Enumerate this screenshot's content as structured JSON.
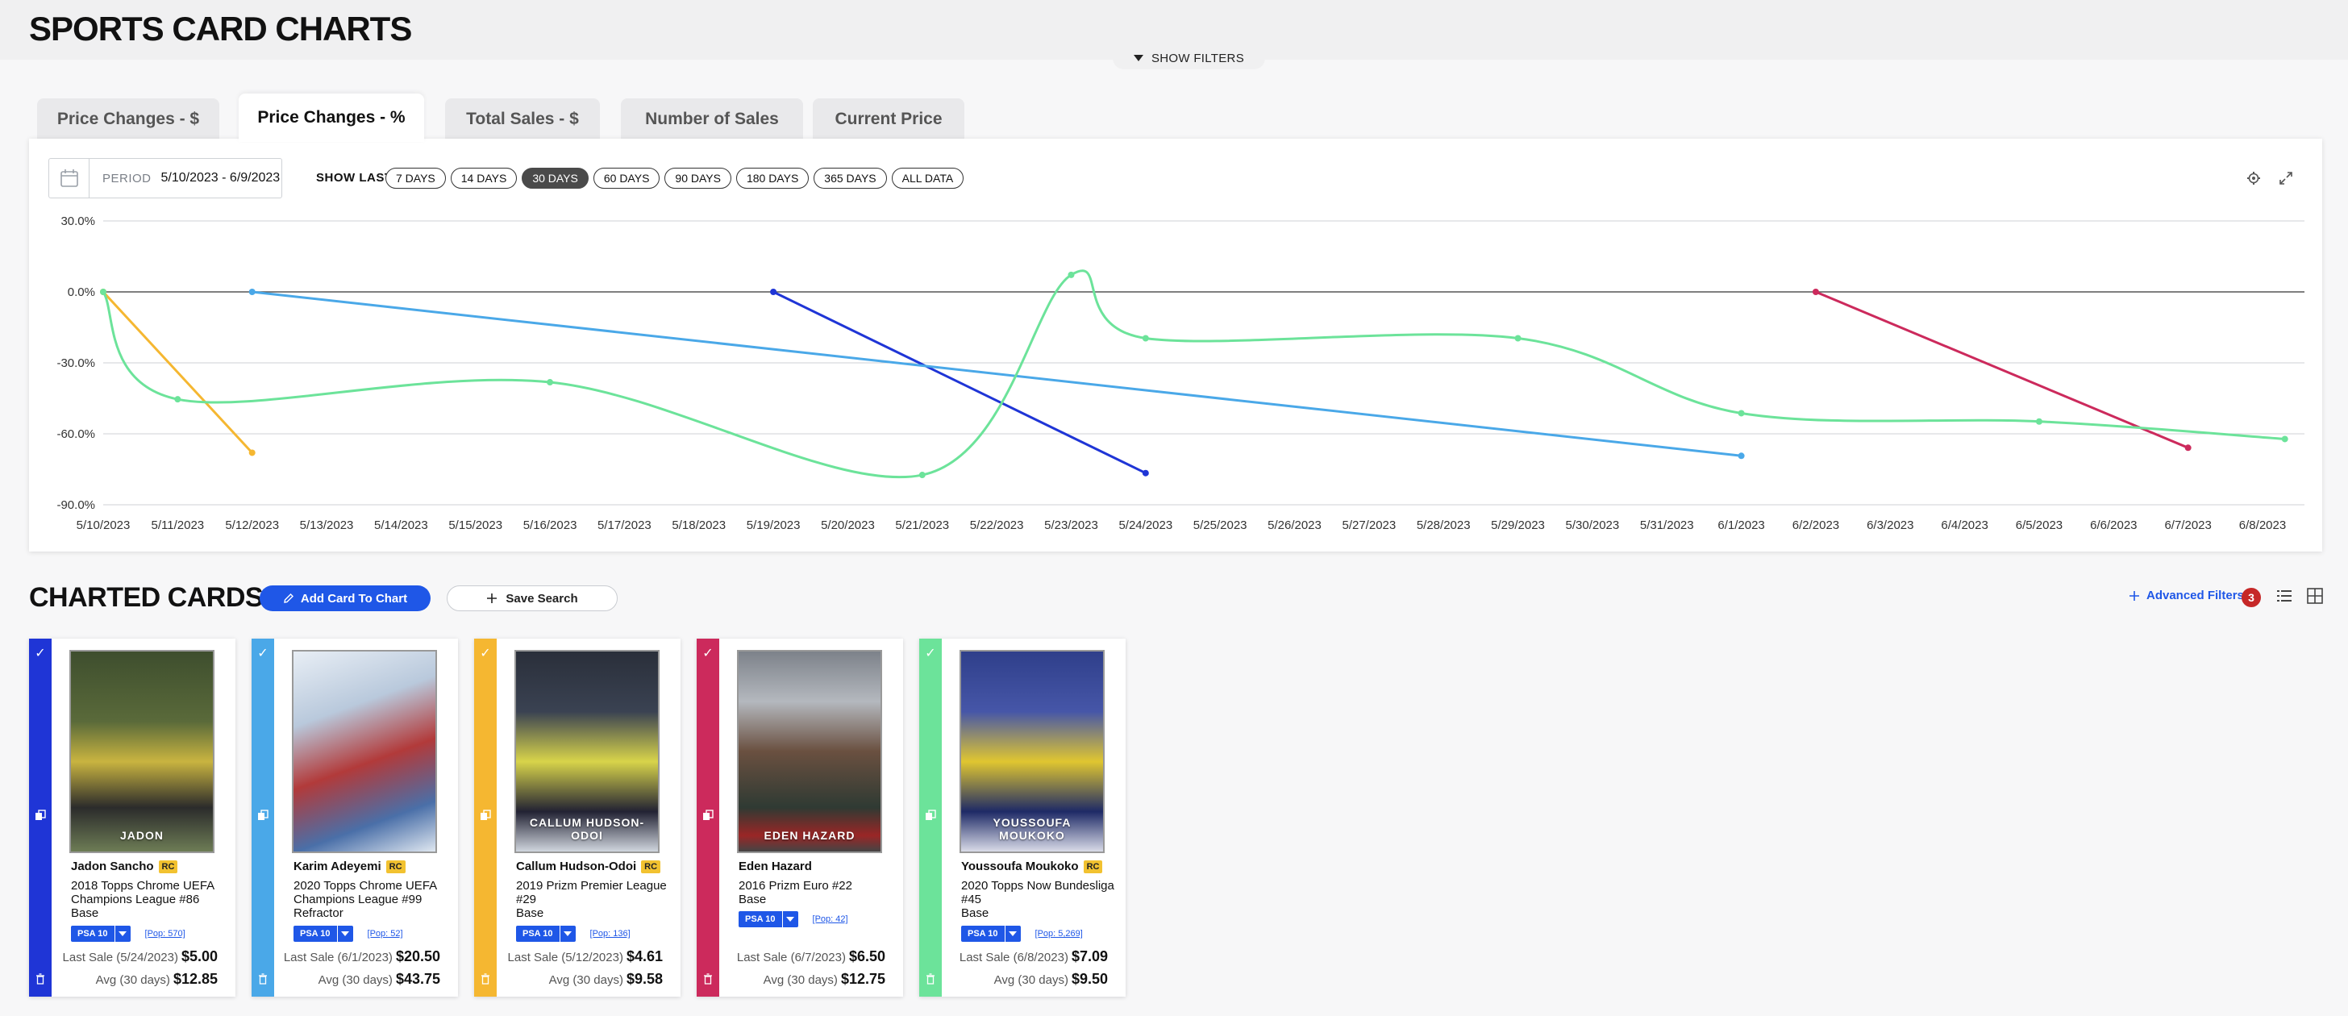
{
  "app": {
    "title": "SPORTS CARD CHARTS",
    "show_filters": "SHOW FILTERS"
  },
  "tabs": [
    {
      "label": "Price Changes - $"
    },
    {
      "label": "Price Changes - %",
      "active": true
    },
    {
      "label": "Total Sales - $"
    },
    {
      "label": "Number of Sales"
    },
    {
      "label": "Current Price"
    }
  ],
  "period": {
    "label": "PERIOD",
    "value": "5/10/2023 - 6/9/2023"
  },
  "show_last": {
    "label": "SHOW LAST",
    "selected": "30 DAYS",
    "options": [
      "7 DAYS",
      "14 DAYS",
      "30 DAYS",
      "60 DAYS",
      "90 DAYS",
      "180 DAYS",
      "365 DAYS",
      "ALL DATA"
    ]
  },
  "icons": {
    "calendar": "calendar-icon",
    "settings": "gear-icon",
    "expand": "expand-icon",
    "pencil": "pencil-icon",
    "plus": "plus-icon",
    "list_view": "list-icon",
    "grid_view": "grid-icon",
    "copy": "copy-icon",
    "trash": "trash-icon",
    "check": "check-icon"
  },
  "chart_data": {
    "type": "line",
    "title": "",
    "xlabel": "",
    "ylabel": "",
    "ylim": [
      -90,
      30
    ],
    "yticks": [
      30,
      0,
      -30,
      -60,
      -90
    ],
    "ytick_labels": [
      "30.0%",
      "0.0%",
      "-30.0%",
      "-60.0%",
      "-90.0%"
    ],
    "categories": [
      "5/10/2023",
      "5/11/2023",
      "5/12/2023",
      "5/13/2023",
      "5/14/2023",
      "5/15/2023",
      "5/16/2023",
      "5/17/2023",
      "5/18/2023",
      "5/19/2023",
      "5/20/2023",
      "5/21/2023",
      "5/22/2023",
      "5/23/2023",
      "5/24/2023",
      "5/25/2023",
      "5/26/2023",
      "5/27/2023",
      "5/28/2023",
      "5/29/2023",
      "5/30/2023",
      "5/31/2023",
      "6/1/2023",
      "6/2/2023",
      "6/3/2023",
      "6/4/2023",
      "6/5/2023",
      "6/6/2023",
      "6/7/2023",
      "6/8/2023"
    ],
    "grid": true,
    "series": [
      {
        "color": "#1f35d6",
        "smooth": false,
        "points": [
          {
            "x": 9,
            "y": 0
          },
          {
            "x": 14,
            "y": -76.6
          }
        ]
      },
      {
        "color": "#4aa8e8",
        "smooth": false,
        "points": [
          {
            "x": 2,
            "y": 0
          },
          {
            "x": 22,
            "y": -69.3
          }
        ]
      },
      {
        "color": "#f5b731",
        "smooth": false,
        "points": [
          {
            "x": 0,
            "y": 0
          },
          {
            "x": 2,
            "y": -68.0
          }
        ]
      },
      {
        "color": "#cc2a5c",
        "smooth": false,
        "points": [
          {
            "x": 23,
            "y": 0
          },
          {
            "x": 28,
            "y": -65.9
          }
        ]
      },
      {
        "color": "#6ce39a",
        "smooth": true,
        "points": [
          {
            "x": 0,
            "y": 0
          },
          {
            "x": 1,
            "y": -45.4
          },
          {
            "x": 6,
            "y": -38.2
          },
          {
            "x": 11,
            "y": -77.4
          },
          {
            "x": 13,
            "y": 7.2
          },
          {
            "x": 14,
            "y": -19.6
          },
          {
            "x": 19,
            "y": -19.6
          },
          {
            "x": 22,
            "y": -51.3
          },
          {
            "x": 26,
            "y": -54.8
          },
          {
            "x": 29.3,
            "y": -62.2
          }
        ]
      }
    ]
  },
  "charted": {
    "title": "CHARTED CARDS",
    "add_label": "Add Card To Chart",
    "save_label": "Save Search",
    "advanced_label": "Advanced Filters",
    "advanced_count": "3"
  },
  "cards": [
    {
      "color": "#1f35d6",
      "name": "Jadon Sancho",
      "rc": "RC",
      "set": "2018 Topps Chrome UEFA Champions League #86",
      "variant": "Base",
      "grade": "PSA 10",
      "pop": "[Pop: 570]",
      "last_label": "Last Sale (5/24/2023)",
      "last_price": "$5.00",
      "avg_label": "Avg (30 days)",
      "avg_price": "$12.85",
      "photo_text": "JADON"
    },
    {
      "color": "#4aa8e8",
      "name": "Karim Adeyemi",
      "rc": "RC",
      "set": "2020 Topps Chrome UEFA Champions League #99",
      "variant": "Refractor",
      "grade": "PSA 10",
      "pop": "[Pop: 52]",
      "last_label": "Last Sale (6/1/2023)",
      "last_price": "$20.50",
      "avg_label": "Avg (30 days)",
      "avg_price": "$43.75",
      "photo_text": ""
    },
    {
      "color": "#f5b731",
      "name": "Callum Hudson-Odoi",
      "rc": "RC",
      "set": "2019 Prizm Premier League #29",
      "variant": "Base",
      "grade": "PSA 10",
      "pop": "[Pop: 136]",
      "last_label": "Last Sale (5/12/2023)",
      "last_price": "$4.61",
      "avg_label": "Avg (30 days)",
      "avg_price": "$9.58",
      "photo_text": "CALLUM HUDSON-ODOI"
    },
    {
      "color": "#cc2a5c",
      "name": "Eden Hazard",
      "rc": "",
      "set": "2016 Prizm Euro #22",
      "variant": "Base",
      "grade": "PSA 10",
      "pop": "[Pop: 42]",
      "last_label": "Last Sale (6/7/2023)",
      "last_price": "$6.50",
      "avg_label": "Avg (30 days)",
      "avg_price": "$12.75",
      "photo_text": "EDEN HAZARD"
    },
    {
      "color": "#6ce39a",
      "name": "Youssoufa Moukoko",
      "rc": "RC",
      "set": "2020 Topps Now Bundesliga #45",
      "variant": "Base",
      "grade": "PSA 10",
      "pop": "[Pop: 5,269]",
      "last_label": "Last Sale (6/8/2023)",
      "last_price": "$7.09",
      "avg_label": "Avg (30 days)",
      "avg_price": "$9.50",
      "photo_text": "YOUSSOUFA MOUKOKO"
    }
  ]
}
